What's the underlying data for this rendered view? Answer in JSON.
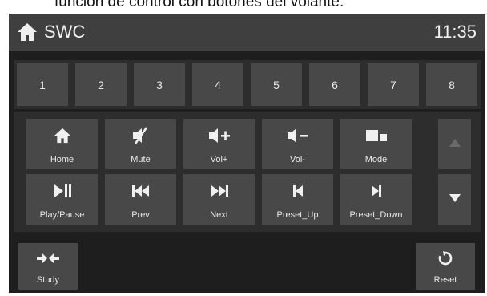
{
  "caption": "función de control con botones del volante.",
  "header": {
    "title": "SWC",
    "clock": "11:35",
    "icon": "home-icon"
  },
  "keys": [
    "1",
    "2",
    "3",
    "4",
    "5",
    "6",
    "7",
    "8"
  ],
  "functions": {
    "row1": [
      {
        "label": "Home",
        "icon": "home-icon"
      },
      {
        "label": "Mute",
        "icon": "mute-icon"
      },
      {
        "label": "Vol+",
        "icon": "volume-up-icon"
      },
      {
        "label": "Vol-",
        "icon": "volume-down-icon"
      },
      {
        "label": "Mode",
        "icon": "mode-icon"
      }
    ],
    "row2": [
      {
        "label": "Play/Pause",
        "icon": "play-pause-icon"
      },
      {
        "label": "Prev",
        "icon": "previous-icon"
      },
      {
        "label": "Next",
        "icon": "next-icon"
      },
      {
        "label": "Preset_Up",
        "icon": "preset-up-icon"
      },
      {
        "label": "Preset_Down",
        "icon": "preset-down-icon"
      }
    ],
    "scroll": {
      "up_icon": "triangle-up-icon",
      "down_icon": "triangle-down-icon"
    }
  },
  "bottom": {
    "study": {
      "label": "Study",
      "icon": "study-arrows-icon"
    },
    "reset": {
      "label": "Reset",
      "icon": "reset-icon"
    }
  },
  "colors": {
    "background": "#1e1e1e",
    "header": "#3f3f3f",
    "button": "#484848",
    "disabled_arrow": "#6a6a6a"
  }
}
